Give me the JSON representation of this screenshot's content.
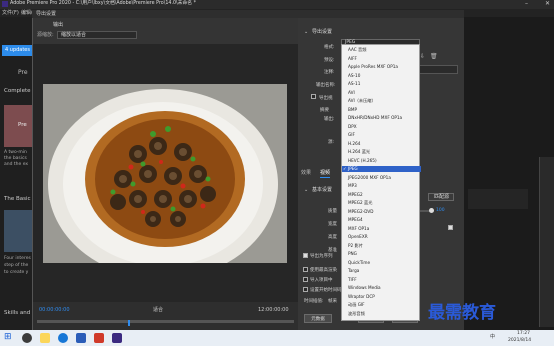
{
  "window": {
    "title": "Adobe Premiere Pro 2020 - C:\\用户\\lbxy\\文档\\Adobe\\Premiere Pro\\14.0\\未命名 *",
    "menu": [
      "文件(F)",
      "编辑(E)"
    ]
  },
  "left": {
    "updates": "4 updates a",
    "items": [
      "Pre",
      "Complete",
      "Pre",
      "A two-min",
      "the basics",
      "and the ex",
      "The Basic",
      "Four interes",
      "step of the",
      "to create y",
      "Skills and"
    ]
  },
  "dialog": {
    "title": "导出设置",
    "source_tab": "输出",
    "source_label": "源缩放:",
    "source_value": "缩放以适合",
    "timecode_start": "00:00:00:00",
    "timecode_end": "12:00:00:00",
    "fit_label": "适合"
  },
  "settings": {
    "export_header": "导出设置",
    "format_label": "格式:",
    "format_value": "JPEG",
    "preset_label": "预设:",
    "notes_label": "注释:",
    "output_name_label": "输出名称:",
    "export_video_label": "导出视",
    "summary_label": "摘要",
    "output_label": "输出:",
    "source_label2": "源:",
    "tabs": [
      "效果",
      "视频"
    ],
    "basic_header": "基本设置",
    "quality_label": "质量",
    "width_label": "宽度",
    "height_label": "高度",
    "base_label": "基准",
    "sequence_label": "导出为序列",
    "use_max_render": "使用最高渲染",
    "import_project": "导入项目中",
    "set_start_timecode": "设置开始时间码",
    "time_interp_label": "时间插值:",
    "time_interp_value": "帧采",
    "quality_value": "100",
    "queue_button": "队列",
    "export_button": "导出",
    "metadata_button": "元数据",
    "browse_button": "匹配源"
  },
  "format_options": [
    "AAC 音频",
    "AIFF",
    "Apple ProRes MXF OP1a",
    "AS-10",
    "AS-11",
    "AVI",
    "AVI（未压缩）",
    "BMP",
    "DNxHR/DNxHD MXF OP1a",
    "DPX",
    "GIF",
    "H.264",
    "H.264 蓝光",
    "HEVC (H.265)",
    "JPEG",
    "JPEG2000 MXF OP1a",
    "MP3",
    "MPEG2",
    "MPEG2 蓝光",
    "MPEG2-DVD",
    "MPEG4",
    "MXF OP1a",
    "OpenEXR",
    "P2 影片",
    "PNG",
    "QuickTime",
    "Targa",
    "TIFF",
    "Windows Media",
    "Wraptor DCP",
    "动画 GIF",
    "波形音频"
  ],
  "selected_format": "JPEG",
  "watermark": "最需教育",
  "taskbar": {
    "time": "17:27",
    "date": "2021/8/14",
    "lang": "中"
  }
}
